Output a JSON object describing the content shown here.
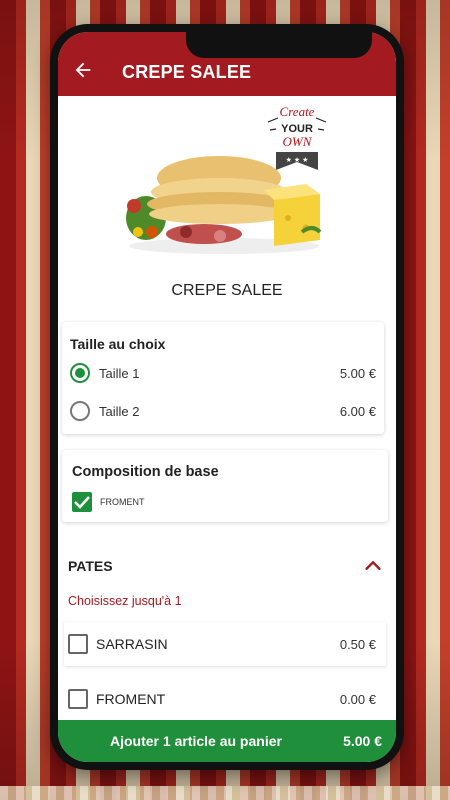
{
  "header": {
    "title": "CREPE SALEE",
    "back_icon": "arrow-left-icon"
  },
  "product": {
    "name": "CREPE SALEE",
    "badge_lines": [
      "Create",
      "YOUR",
      "OWN"
    ],
    "image_icon": "crepe-food-image"
  },
  "size_section": {
    "title": "Taille au choix",
    "options": [
      {
        "label": "Taille 1",
        "price": "5.00 €",
        "selected": true
      },
      {
        "label": "Taille 2",
        "price": "6.00 €",
        "selected": false
      }
    ]
  },
  "base_section": {
    "title": "Composition de base",
    "items": [
      {
        "label": "FROMENT",
        "checked": true
      }
    ]
  },
  "pates_section": {
    "title": "PATES",
    "hint": "Choisissez jusqu'à 1",
    "options": [
      {
        "label": "SARRASIN",
        "price": "0.50 €",
        "checked": false
      },
      {
        "label": "FROMENT",
        "price": "0.00 €",
        "checked": false
      }
    ]
  },
  "cart": {
    "label": "Ajouter 1 article au panier",
    "price": "5.00 €"
  },
  "colors": {
    "brand_red": "#a31b20",
    "green": "#1f8f3b"
  }
}
